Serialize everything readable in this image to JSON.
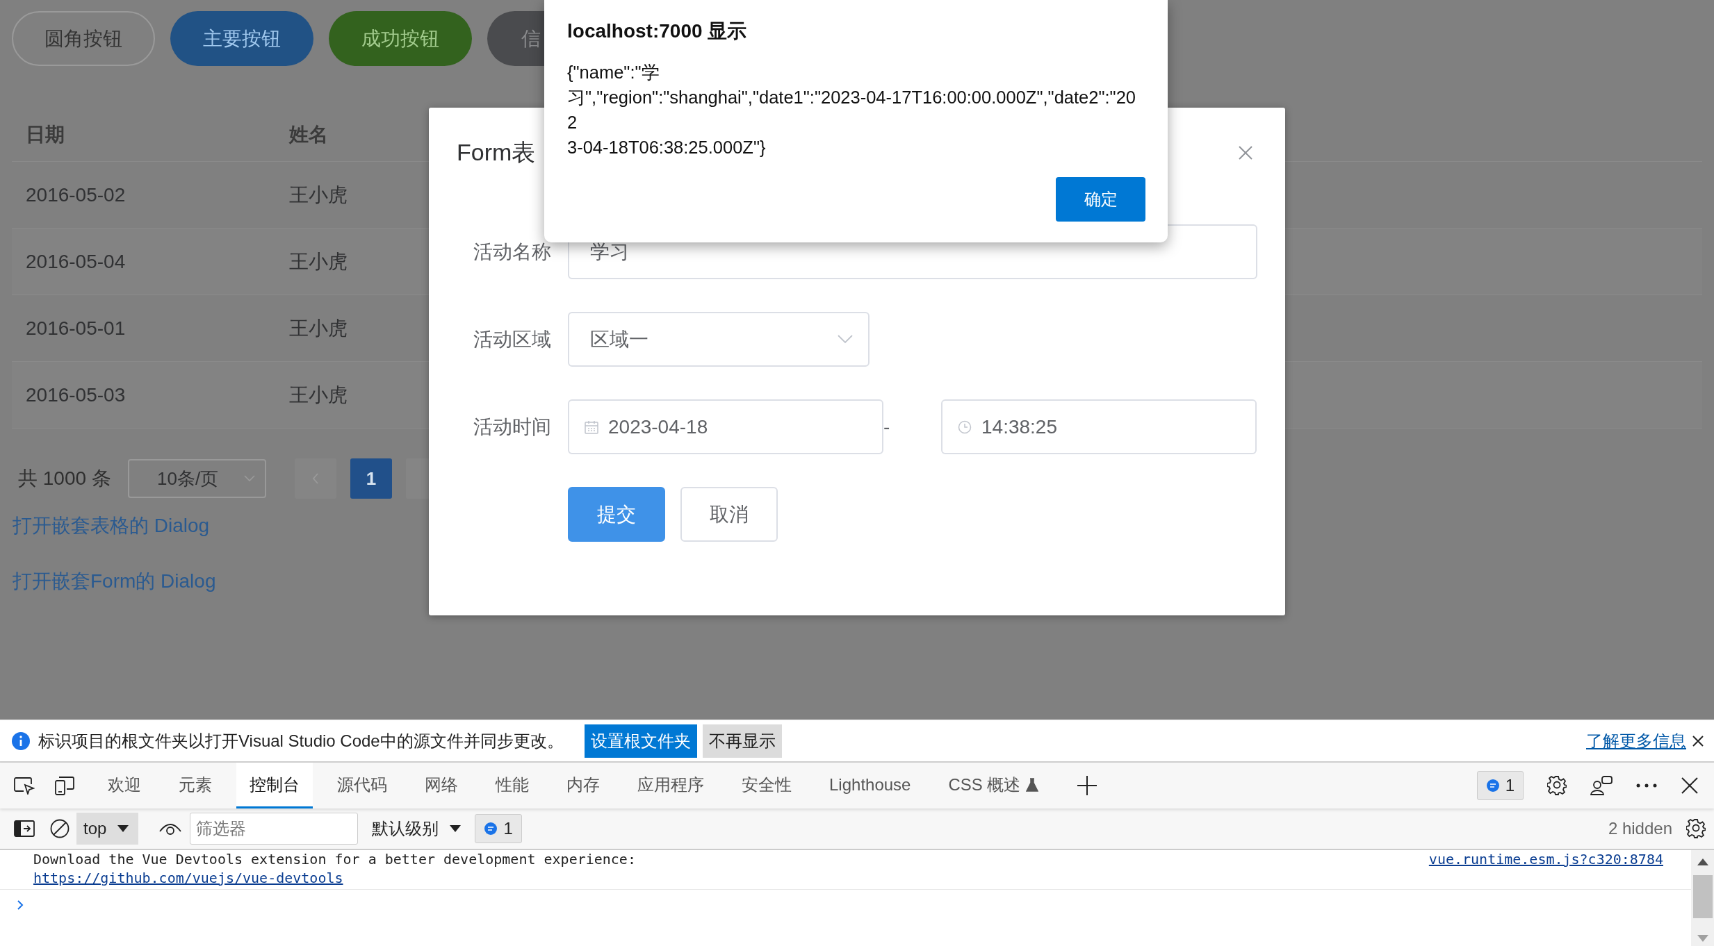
{
  "page": {
    "buttons": [
      {
        "label": "圆角按钮",
        "kind": "default"
      },
      {
        "label": "主要按钮",
        "kind": "primary"
      },
      {
        "label": "成功按钮",
        "kind": "success"
      },
      {
        "label": "信",
        "kind": "info"
      }
    ],
    "table": {
      "columns": [
        "日期",
        "姓名"
      ],
      "rows": [
        {
          "date": "2016-05-02",
          "name": "王小虎"
        },
        {
          "date": "2016-05-04",
          "name": "王小虎"
        },
        {
          "date": "2016-05-01",
          "name": "王小虎"
        },
        {
          "date": "2016-05-03",
          "name": "王小虎"
        }
      ]
    },
    "pagination": {
      "total": "共 1000 条",
      "page_size": "10条/页",
      "pages": [
        {
          "label": "1",
          "selected": true
        }
      ]
    },
    "links": [
      "打开嵌套表格的 Dialog",
      "打开嵌套Form的 Dialog"
    ]
  },
  "dialog": {
    "title": "Form表",
    "fields": [
      {
        "kind": "text",
        "label": "活动名称",
        "value": "学习"
      },
      {
        "kind": "select",
        "label": "活动区域",
        "value": "区域一"
      },
      {
        "kind": "datetime",
        "label": "活动时间",
        "date": "2023-04-18",
        "separator": "-",
        "time": "14:38:25"
      }
    ],
    "buttons": [
      {
        "label": "提交",
        "kind": "primary"
      },
      {
        "label": "取消",
        "kind": "default"
      }
    ]
  },
  "alert": {
    "title": "localhost:7000 显示",
    "message_lines": [
      "{\"name\":\"学",
      "习\",\"region\":\"shanghai\",\"date1\":\"2023-04-17T16:00:00.000Z\",\"date2\":\"20",
      "2",
      "3-04-18T06:38:25.000Z\"}"
    ],
    "button": "确定"
  },
  "devtools": {
    "infobar": {
      "message": "标识项目的根文件夹以打开Visual Studio Code中的源文件并同步更改。",
      "buttons": [
        {
          "label": "设置根文件夹",
          "kind": "primary"
        },
        {
          "label": "不再显示",
          "kind": "secondary"
        }
      ],
      "link": "了解更多信息"
    },
    "tabs": [
      {
        "label": "欢迎",
        "selected": false,
        "experimental": false
      },
      {
        "label": "元素",
        "selected": false,
        "experimental": false
      },
      {
        "label": "控制台",
        "selected": true,
        "experimental": false
      },
      {
        "label": "源代码",
        "selected": false,
        "experimental": false
      },
      {
        "label": "网络",
        "selected": false,
        "experimental": false
      },
      {
        "label": "性能",
        "selected": false,
        "experimental": false
      },
      {
        "label": "内存",
        "selected": false,
        "experimental": false
      },
      {
        "label": "应用程序",
        "selected": false,
        "experimental": false
      },
      {
        "label": "安全性",
        "selected": false,
        "experimental": false
      },
      {
        "label": "Lighthouse",
        "selected": false,
        "experimental": false
      },
      {
        "label": "CSS 概述",
        "selected": false,
        "experimental": true
      }
    ],
    "issues_count": "1",
    "console_toolbar": {
      "context": "top",
      "filter_placeholder": "筛选器",
      "level": "默认级别",
      "message_count": "1",
      "hidden": "2 hidden"
    },
    "messages": [
      {
        "text": "Download the Vue Devtools extension for a better development experience:",
        "link": "https://github.com/vuejs/vue-devtools",
        "source": "vue.runtime.esm.js?c320:8784"
      }
    ]
  }
}
